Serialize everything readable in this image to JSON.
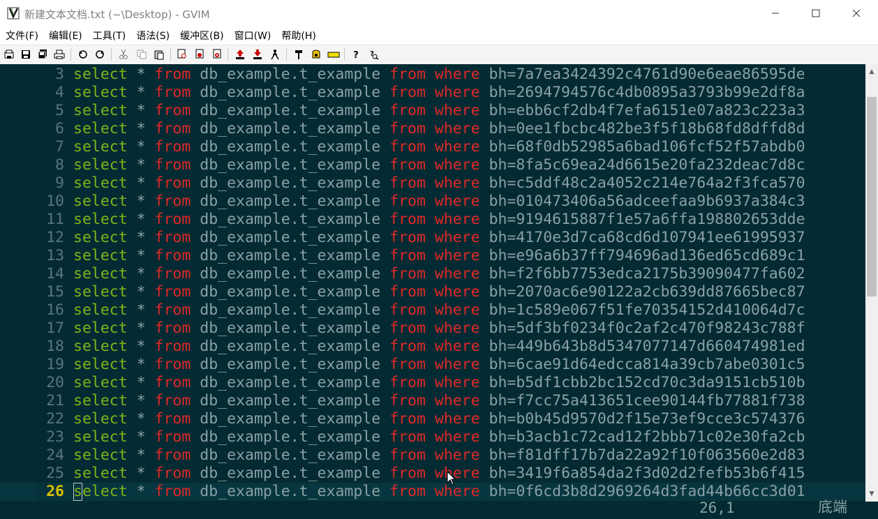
{
  "window": {
    "title": "新建文本文档.txt (~\\Desktop) - GVIM",
    "min_glyph": "—",
    "max_glyph": "☐",
    "close_glyph": "✕"
  },
  "menu": [
    "文件(F)",
    "编辑(E)",
    "工具(T)",
    "语法(S)",
    "缓冲区(B)",
    "窗口(W)",
    "帮助(H)"
  ],
  "toolbar_icons": [
    "open-icon",
    "save-icon",
    "save-all-icon",
    "print-icon",
    "undo-icon",
    "redo-icon",
    "cut-icon",
    "copy-icon",
    "paste-icon",
    "find-replace-icon",
    "find-next-icon",
    "find-prev-icon",
    "load-session-icon",
    "save-session-icon",
    "run-script-icon",
    "make-icon",
    "shell-icon",
    "tags-icon",
    "help-icon",
    "find-help-icon"
  ],
  "editor": {
    "lines": [
      {
        "num": "3",
        "kw1": "select",
        "star": "*",
        "kw2": "from",
        "table": "db_example.t_example",
        "kw3": "from",
        "kw4": "where",
        "cond": "bh=7a7ea3424392c4761d90e6eae86595de"
      },
      {
        "num": "4",
        "kw1": "select",
        "star": "*",
        "kw2": "from",
        "table": "db_example.t_example",
        "kw3": "from",
        "kw4": "where",
        "cond": "bh=2694794576c4db0895a3793b99e2df8a"
      },
      {
        "num": "5",
        "kw1": "select",
        "star": "*",
        "kw2": "from",
        "table": "db_example.t_example",
        "kw3": "from",
        "kw4": "where",
        "cond": "bh=ebb6cf2db4f7efa6151e07a823c223a3"
      },
      {
        "num": "6",
        "kw1": "select",
        "star": "*",
        "kw2": "from",
        "table": "db_example.t_example",
        "kw3": "from",
        "kw4": "where",
        "cond": "bh=0ee1fbcbc482be3f5f18b68fd8dffd8d"
      },
      {
        "num": "7",
        "kw1": "select",
        "star": "*",
        "kw2": "from",
        "table": "db_example.t_example",
        "kw3": "from",
        "kw4": "where",
        "cond": "bh=68f0db52985a6bad106fcf52f57abdb0"
      },
      {
        "num": "8",
        "kw1": "select",
        "star": "*",
        "kw2": "from",
        "table": "db_example.t_example",
        "kw3": "from",
        "kw4": "where",
        "cond": "bh=8fa5c69ea24d6615e20fa232deac7d8c"
      },
      {
        "num": "9",
        "kw1": "select",
        "star": "*",
        "kw2": "from",
        "table": "db_example.t_example",
        "kw3": "from",
        "kw4": "where",
        "cond": "bh=c5ddf48c2a4052c214e764a2f3fca570"
      },
      {
        "num": "10",
        "kw1": "select",
        "star": "*",
        "kw2": "from",
        "table": "db_example.t_example",
        "kw3": "from",
        "kw4": "where",
        "cond": "bh=010473406a56adceefaa9b6937a384c3"
      },
      {
        "num": "11",
        "kw1": "select",
        "star": "*",
        "kw2": "from",
        "table": "db_example.t_example",
        "kw3": "from",
        "kw4": "where",
        "cond": "bh=9194615887f1e57a6ffa198802653dde"
      },
      {
        "num": "12",
        "kw1": "select",
        "star": "*",
        "kw2": "from",
        "table": "db_example.t_example",
        "kw3": "from",
        "kw4": "where",
        "cond": "bh=4170e3d7ca68cd6d107941ee61995937"
      },
      {
        "num": "13",
        "kw1": "select",
        "star": "*",
        "kw2": "from",
        "table": "db_example.t_example",
        "kw3": "from",
        "kw4": "where",
        "cond": "bh=e96a6b37ff794696ad136ed65cd689c1"
      },
      {
        "num": "14",
        "kw1": "select",
        "star": "*",
        "kw2": "from",
        "table": "db_example.t_example",
        "kw3": "from",
        "kw4": "where",
        "cond": "bh=f2f6bb7753edca2175b39090477fa602"
      },
      {
        "num": "15",
        "kw1": "select",
        "star": "*",
        "kw2": "from",
        "table": "db_example.t_example",
        "kw3": "from",
        "kw4": "where",
        "cond": "bh=2070ac6e90122a2cb639dd87665bec87"
      },
      {
        "num": "16",
        "kw1": "select",
        "star": "*",
        "kw2": "from",
        "table": "db_example.t_example",
        "kw3": "from",
        "kw4": "where",
        "cond": "bh=1c589e067f51fe70354152d410064d7c"
      },
      {
        "num": "17",
        "kw1": "select",
        "star": "*",
        "kw2": "from",
        "table": "db_example.t_example",
        "kw3": "from",
        "kw4": "where",
        "cond": "bh=5df3bf0234f0c2af2c470f98243c788f"
      },
      {
        "num": "18",
        "kw1": "select",
        "star": "*",
        "kw2": "from",
        "table": "db_example.t_example",
        "kw3": "from",
        "kw4": "where",
        "cond": "bh=449b643b8d5347077147d660474981ed"
      },
      {
        "num": "19",
        "kw1": "select",
        "star": "*",
        "kw2": "from",
        "table": "db_example.t_example",
        "kw3": "from",
        "kw4": "where",
        "cond": "bh=6cae91d64edcca814a39cb7abe0301c5"
      },
      {
        "num": "20",
        "kw1": "select",
        "star": "*",
        "kw2": "from",
        "table": "db_example.t_example",
        "kw3": "from",
        "kw4": "where",
        "cond": "bh=b5df1cbb2bc152cd70c3da9151cb510b"
      },
      {
        "num": "21",
        "kw1": "select",
        "star": "*",
        "kw2": "from",
        "table": "db_example.t_example",
        "kw3": "from",
        "kw4": "where",
        "cond": "bh=f7cc75a413651cee90144fb77881f738"
      },
      {
        "num": "22",
        "kw1": "select",
        "star": "*",
        "kw2": "from",
        "table": "db_example.t_example",
        "kw3": "from",
        "kw4": "where",
        "cond": "bh=b0b45d9570d2f15e73ef9cce3c574376"
      },
      {
        "num": "23",
        "kw1": "select",
        "star": "*",
        "kw2": "from",
        "table": "db_example.t_example",
        "kw3": "from",
        "kw4": "where",
        "cond": "bh=b3acb1c72cad12f2bbb71c02e30fa2cb"
      },
      {
        "num": "24",
        "kw1": "select",
        "star": "*",
        "kw2": "from",
        "table": "db_example.t_example",
        "kw3": "from",
        "kw4": "where",
        "cond": "bh=f81dff17b7da22a92f10f063560e2d83"
      },
      {
        "num": "25",
        "kw1": "select",
        "star": "*",
        "kw2": "from",
        "table": "db_example.t_example",
        "kw3": "from",
        "kw4": "where",
        "cond": "bh=3419f6a854da2f3d02d2fefb53b6f415"
      },
      {
        "num": "26",
        "kw1": "select",
        "star": "*",
        "kw2": "from",
        "table": "db_example.t_example",
        "kw3": "from",
        "kw4": "where",
        "cond": "bh=0f6cd3b8d2969264d3fad44b66cc3d01"
      }
    ],
    "current_line": "26"
  },
  "statusline": {
    "ruler": "26,1",
    "position": "底端"
  },
  "colors": {
    "background": "#042b33",
    "select_keyword": "#7fb31a",
    "from_where_keyword": "#e02828",
    "text": "#8aa0a6",
    "line_number": "#5a7480",
    "current_line_number": "#d7c100"
  }
}
